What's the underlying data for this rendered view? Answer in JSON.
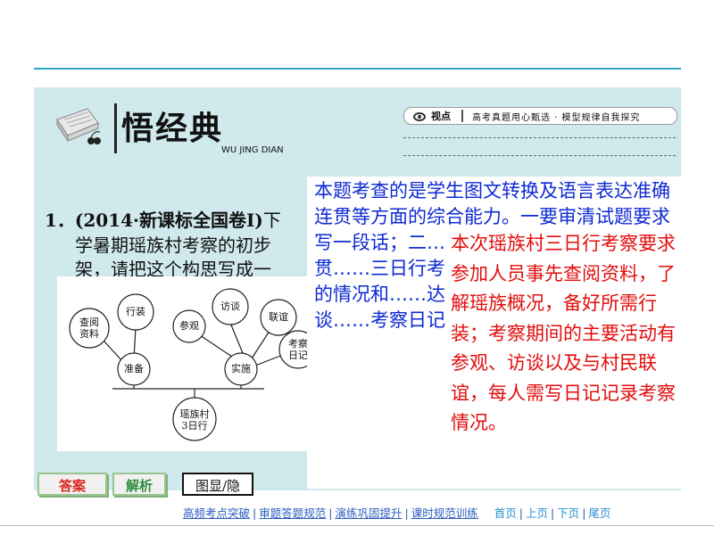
{
  "header": {
    "title": "悟经典",
    "subtitle": "WU JING DIAN",
    "viewpoint_label": "视点",
    "viewpoint_text": "高考真题用心甄选 · 模型规律自我探究"
  },
  "question": {
    "number": "1．",
    "source": "(2014·新课标全国卷Ⅰ)",
    "line1_rest": "下",
    "line2": "学暑期瑶族村考察的初步",
    "line3": "架，请把这个构思写成一"
  },
  "diagram": {
    "nodes": {
      "root": "瑶族村\n3日行",
      "prep": "准备",
      "impl": "实施",
      "research": "查阅\n资料",
      "gear": "行装",
      "visit": "参观",
      "interview": "访谈",
      "friend": "联谊",
      "diary": "考察\n日记"
    }
  },
  "analysis": {
    "blue_text": "本题考查的是学生图文转换及语言表达准确连贯等方面的综合能力。一要审清试题要求写一段话；二……其体现在语……准确、连贯……三日行考察……考察前的“准……族的情况和……达之后的“实……、进行访谈……考察日记。将……起来即可。",
    "red_text": "本次瑶族村三日行考察要求参加人员事先查阅资料，了解瑶族概况，备好所需行装；考察期间的主要活动有参观、访谈以及与村民联谊，每人需写日记记录考察情况。"
  },
  "buttons": {
    "answer": "答案",
    "analysis": "解析",
    "toggle": "图显/隐"
  },
  "nav": {
    "links": [
      "高频考点突破",
      "审题答题规范",
      "演练巩固提升",
      "课时规范训练"
    ],
    "pages": [
      "首页",
      "上页",
      "下页",
      "尾页"
    ]
  },
  "colors": {
    "panel": "#cfe9ec",
    "accent_line": "#2ea3c8",
    "blue_text": "#0e2ad4",
    "red_text": "#e40d0d"
  }
}
